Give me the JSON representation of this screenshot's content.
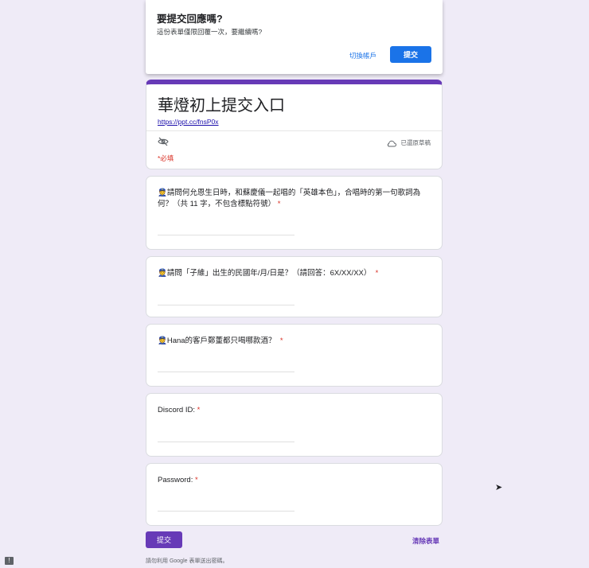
{
  "dialog": {
    "title": "要提交回應嗎?",
    "message": "這份表單僅限回覆一次，要繼續嗎?",
    "switch_account": "切換帳戶",
    "submit": "提交"
  },
  "form": {
    "title": "華燈初上提交入口",
    "link": "https://ppt.cc/fnsP0x",
    "saved_status": "已還原草稿",
    "required_note": "*必填"
  },
  "questions": [
    {
      "emoji": "👮",
      "text": "請問何允恩生日時，和蘇慶儀一起唱的「英雄本色」，合唱時的第一句歌詞為何？（共 11 字，不包含標點符號）",
      "star": "*"
    },
    {
      "emoji": "👮",
      "text": "請問「子維」出生的民國年/月/日是？（請回答：6X/XX/XX）",
      "star": "*"
    },
    {
      "emoji": "👮",
      "text": "Hana的客戶鄭董都只喝哪款酒？",
      "star": "*"
    },
    {
      "emoji": "",
      "text": "Discord ID:",
      "star": "*"
    },
    {
      "emoji": "",
      "text": "Password:",
      "star": "*"
    }
  ],
  "footer": {
    "submit": "提交",
    "clear": "清除表單",
    "warning": "請勿利用 Google 表單送出密碼。",
    "report_icon": "!"
  }
}
